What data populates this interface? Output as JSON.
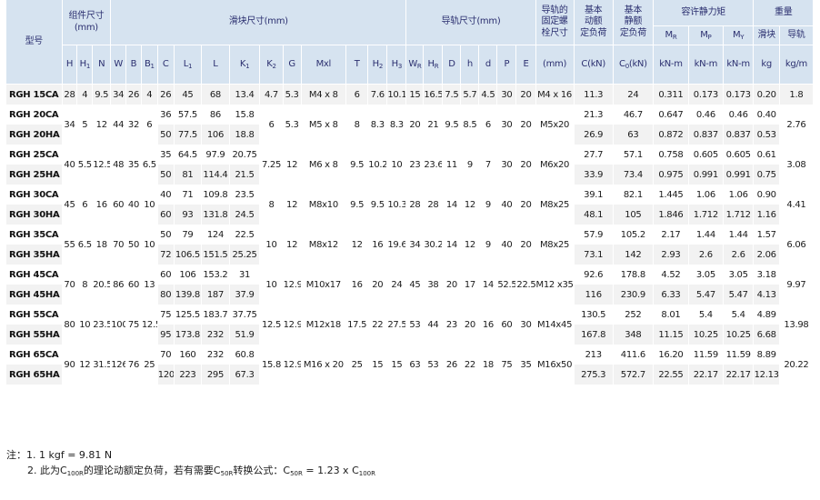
{
  "header": {
    "model": "型号",
    "assembly": "组件尺寸\n(mm)",
    "block": "滑块尺寸(mm)",
    "rail": "导轨尺寸(mm)",
    "rail_bolt": "导轨的\n固定螺\n栓尺寸",
    "dyn_load": "基本\n动额\n定负荷",
    "stat_load": "基本\n静额\n定负荷",
    "static_moment": "容许静力矩",
    "weight": "重量",
    "weight_block": "滑块",
    "weight_rail": "导轨",
    "cols_assembly": [
      "H",
      "H1",
      "N"
    ],
    "cols_block": [
      "W",
      "B",
      "B1",
      "C",
      "L1",
      "L",
      "K1",
      "K2",
      "G",
      "Mxl",
      "T",
      "H2",
      "H3"
    ],
    "cols_rail": [
      "WR",
      "HR",
      "D",
      "h",
      "d",
      "P",
      "E"
    ],
    "bolt_unit": "(mm)",
    "dyn_unit": "C(kN)",
    "stat_unit": "C0(kN)",
    "moments": [
      "MR",
      "MP",
      "MY"
    ],
    "moment_unit": "kN-m",
    "weight_block_unit": "kg",
    "weight_rail_unit": "kg/m"
  },
  "rows": [
    {
      "model": "RGH 15CA",
      "H": "28",
      "H1": "4",
      "N": "9.5",
      "W": "34",
      "B": "26",
      "B1": "4",
      "C": "26",
      "L1": "45",
      "L": "68",
      "K1": "13.4",
      "K2": "4.7",
      "G": "5.3",
      "Mxl": "M4 x 8",
      "T": "6",
      "H2": "7.6",
      "H3": "10.1",
      "WR": "15",
      "HR": "16.5",
      "D": "7.5",
      "h": "5.7",
      "d": "4.5",
      "P": "30",
      "E": "20",
      "bolt": "M4 x 16",
      "Cdyn": "11.3",
      "C0": "24",
      "MR": "0.311",
      "MP": "0.173",
      "MY": "0.173",
      "wblock": "0.20",
      "wrail": "1.8"
    },
    {
      "model": "RGH 20CA",
      "C": "36",
      "L1": "57.5",
      "L": "86",
      "K1": "15.8",
      "Cdyn": "21.3",
      "C0": "46.7",
      "MR": "0.647",
      "MP": "0.46",
      "MY": "0.46",
      "wblock": "0.40"
    },
    {
      "model": "RGH 20HA",
      "C": "50",
      "L1": "77.5",
      "L": "106",
      "K1": "18.8",
      "Cdyn": "26.9",
      "C0": "63",
      "MR": "0.872",
      "MP": "0.837",
      "MY": "0.837",
      "wblock": "0.53"
    },
    {
      "model": "RGH 25CA",
      "C": "35",
      "L1": "64.5",
      "L": "97.9",
      "K1": "20.75",
      "Cdyn": "27.7",
      "C0": "57.1",
      "MR": "0.758",
      "MP": "0.605",
      "MY": "0.605",
      "wblock": "0.61"
    },
    {
      "model": "RGH 25HA",
      "C": "50",
      "L1": "81",
      "L": "114.4",
      "K1": "21.5",
      "Cdyn": "33.9",
      "C0": "73.4",
      "MR": "0.975",
      "MP": "0.991",
      "MY": "0.991",
      "wblock": "0.75"
    },
    {
      "model": "RGH 30CA",
      "C": "40",
      "L1": "71",
      "L": "109.8",
      "K1": "23.5",
      "Cdyn": "39.1",
      "C0": "82.1",
      "MR": "1.445",
      "MP": "1.06",
      "MY": "1.06",
      "wblock": "0.90"
    },
    {
      "model": "RGH 30HA",
      "C": "60",
      "L1": "93",
      "L": "131.8",
      "K1": "24.5",
      "Cdyn": "48.1",
      "C0": "105",
      "MR": "1.846",
      "MP": "1.712",
      "MY": "1.712",
      "wblock": "1.16"
    },
    {
      "model": "RGH 35CA",
      "C": "50",
      "L1": "79",
      "L": "124",
      "K1": "22.5",
      "Cdyn": "57.9",
      "C0": "105.2",
      "MR": "2.17",
      "MP": "1.44",
      "MY": "1.44",
      "wblock": "1.57"
    },
    {
      "model": "RGH 35HA",
      "C": "72",
      "L1": "106.5",
      "L": "151.5",
      "K1": "25.25",
      "Cdyn": "73.1",
      "C0": "142",
      "MR": "2.93",
      "MP": "2.6",
      "MY": "2.6",
      "wblock": "2.06"
    },
    {
      "model": "RGH 45CA",
      "C": "60",
      "L1": "106",
      "L": "153.2",
      "K1": "31",
      "Cdyn": "92.6",
      "C0": "178.8",
      "MR": "4.52",
      "MP": "3.05",
      "MY": "3.05",
      "wblock": "3.18"
    },
    {
      "model": "RGH 45HA",
      "C": "80",
      "L1": "139.8",
      "L": "187",
      "K1": "37.9",
      "Cdyn": "116",
      "C0": "230.9",
      "MR": "6.33",
      "MP": "5.47",
      "MY": "5.47",
      "wblock": "4.13"
    },
    {
      "model": "RGH 55CA",
      "C": "75",
      "L1": "125.5",
      "L": "183.7",
      "K1": "37.75",
      "Cdyn": "130.5",
      "C0": "252",
      "MR": "8.01",
      "MP": "5.4",
      "MY": "5.4",
      "wblock": "4.89"
    },
    {
      "model": "RGH 55HA",
      "C": "95",
      "L1": "173.8",
      "L": "232",
      "K1": "51.9",
      "Cdyn": "167.8",
      "C0": "348",
      "MR": "11.15",
      "MP": "10.25",
      "MY": "10.25",
      "wblock": "6.68"
    },
    {
      "model": "RGH 65CA",
      "C": "70",
      "L1": "160",
      "L": "232",
      "K1": "60.8",
      "Cdyn": "213",
      "C0": "411.6",
      "MR": "16.20",
      "MP": "11.59",
      "MY": "11.59",
      "wblock": "8.89"
    },
    {
      "model": "RGH 65HA",
      "C": "120",
      "L1": "223",
      "L": "295",
      "K1": "67.3",
      "Cdyn": "275.3",
      "C0": "572.7",
      "MR": "22.55",
      "MP": "22.17",
      "MY": "22.17",
      "wblock": "12.13"
    }
  ],
  "groups": [
    {
      "H": "34",
      "H1": "5",
      "N": "12",
      "W": "44",
      "B": "32",
      "B1": "6",
      "K2": "6",
      "G": "5.3",
      "Mxl": "M5 x 8",
      "T": "8",
      "H2": "8.3",
      "H3": "8.3",
      "WR": "20",
      "HR": "21",
      "D": "9.5",
      "h": "8.5",
      "d": "6",
      "P": "30",
      "E": "20",
      "bolt": "M5x20",
      "wrail": "2.76"
    },
    {
      "H": "40",
      "H1": "5.5",
      "N": "12.5",
      "W": "48",
      "B": "35",
      "B1": "6.5",
      "K2": "7.25",
      "G": "12",
      "Mxl": "M6 x 8",
      "T": "9.5",
      "H2": "10.2",
      "H3": "10",
      "WR": "23",
      "HR": "23.6",
      "D": "11",
      "h": "9",
      "d": "7",
      "P": "30",
      "E": "20",
      "bolt": "M6x20",
      "wrail": "3.08"
    },
    {
      "H": "45",
      "H1": "6",
      "N": "16",
      "W": "60",
      "B": "40",
      "B1": "10",
      "K2": "8",
      "G": "12",
      "Mxl": "M8x10",
      "T": "9.5",
      "H2": "9.5",
      "H3": "10.3",
      "WR": "28",
      "HR": "28",
      "D": "14",
      "h": "12",
      "d": "9",
      "P": "40",
      "E": "20",
      "bolt": "M8x25",
      "wrail": "4.41"
    },
    {
      "H": "55",
      "H1": "6.5",
      "N": "18",
      "W": "70",
      "B": "50",
      "B1": "10",
      "K2": "10",
      "G": "12",
      "Mxl": "M8x12",
      "T": "12",
      "H2": "16",
      "H3": "19.6",
      "WR": "34",
      "HR": "30.2",
      "D": "14",
      "h": "12",
      "d": "9",
      "P": "40",
      "E": "20",
      "bolt": "M8x25",
      "wrail": "6.06"
    },
    {
      "H": "70",
      "H1": "8",
      "N": "20.5",
      "W": "86",
      "B": "60",
      "B1": "13",
      "K2": "10",
      "G": "12.9",
      "Mxl": "M10x17",
      "T": "16",
      "H2": "20",
      "H3": "24",
      "WR": "45",
      "HR": "38",
      "D": "20",
      "h": "17",
      "d": "14",
      "P": "52.5",
      "E": "22.5",
      "bolt": "M12 x35",
      "wrail": "9.97"
    },
    {
      "H": "80",
      "H1": "10",
      "N": "23.5",
      "W": "100",
      "B": "75",
      "B1": "12.5",
      "K2": "12.5",
      "G": "12.9",
      "Mxl": "M12x18",
      "T": "17.5",
      "H2": "22",
      "H3": "27.5",
      "WR": "53",
      "HR": "44",
      "D": "23",
      "h": "20",
      "d": "16",
      "P": "60",
      "E": "30",
      "bolt": "M14x45",
      "wrail": "13.98"
    },
    {
      "H": "90",
      "H1": "12",
      "N": "31.5",
      "W": "126",
      "B": "76",
      "B1": "25",
      "K2": "15.8",
      "G": "12.9",
      "Mxl": "M16 x 20",
      "T": "25",
      "H2": "15",
      "H3": "15",
      "WR": "63",
      "HR": "53",
      "D": "26",
      "h": "22",
      "d": "18",
      "P": "75",
      "E": "35",
      "bolt": "M16x50",
      "wrail": "20.22"
    }
  ],
  "notes": {
    "prefix": "注：",
    "note1": "1.  1 kgf = 9.81 N",
    "note2": "2.  此为C100R的理论动额定负荷，若有需要C50R转换公式：C50R = 1.23 x C100R"
  }
}
